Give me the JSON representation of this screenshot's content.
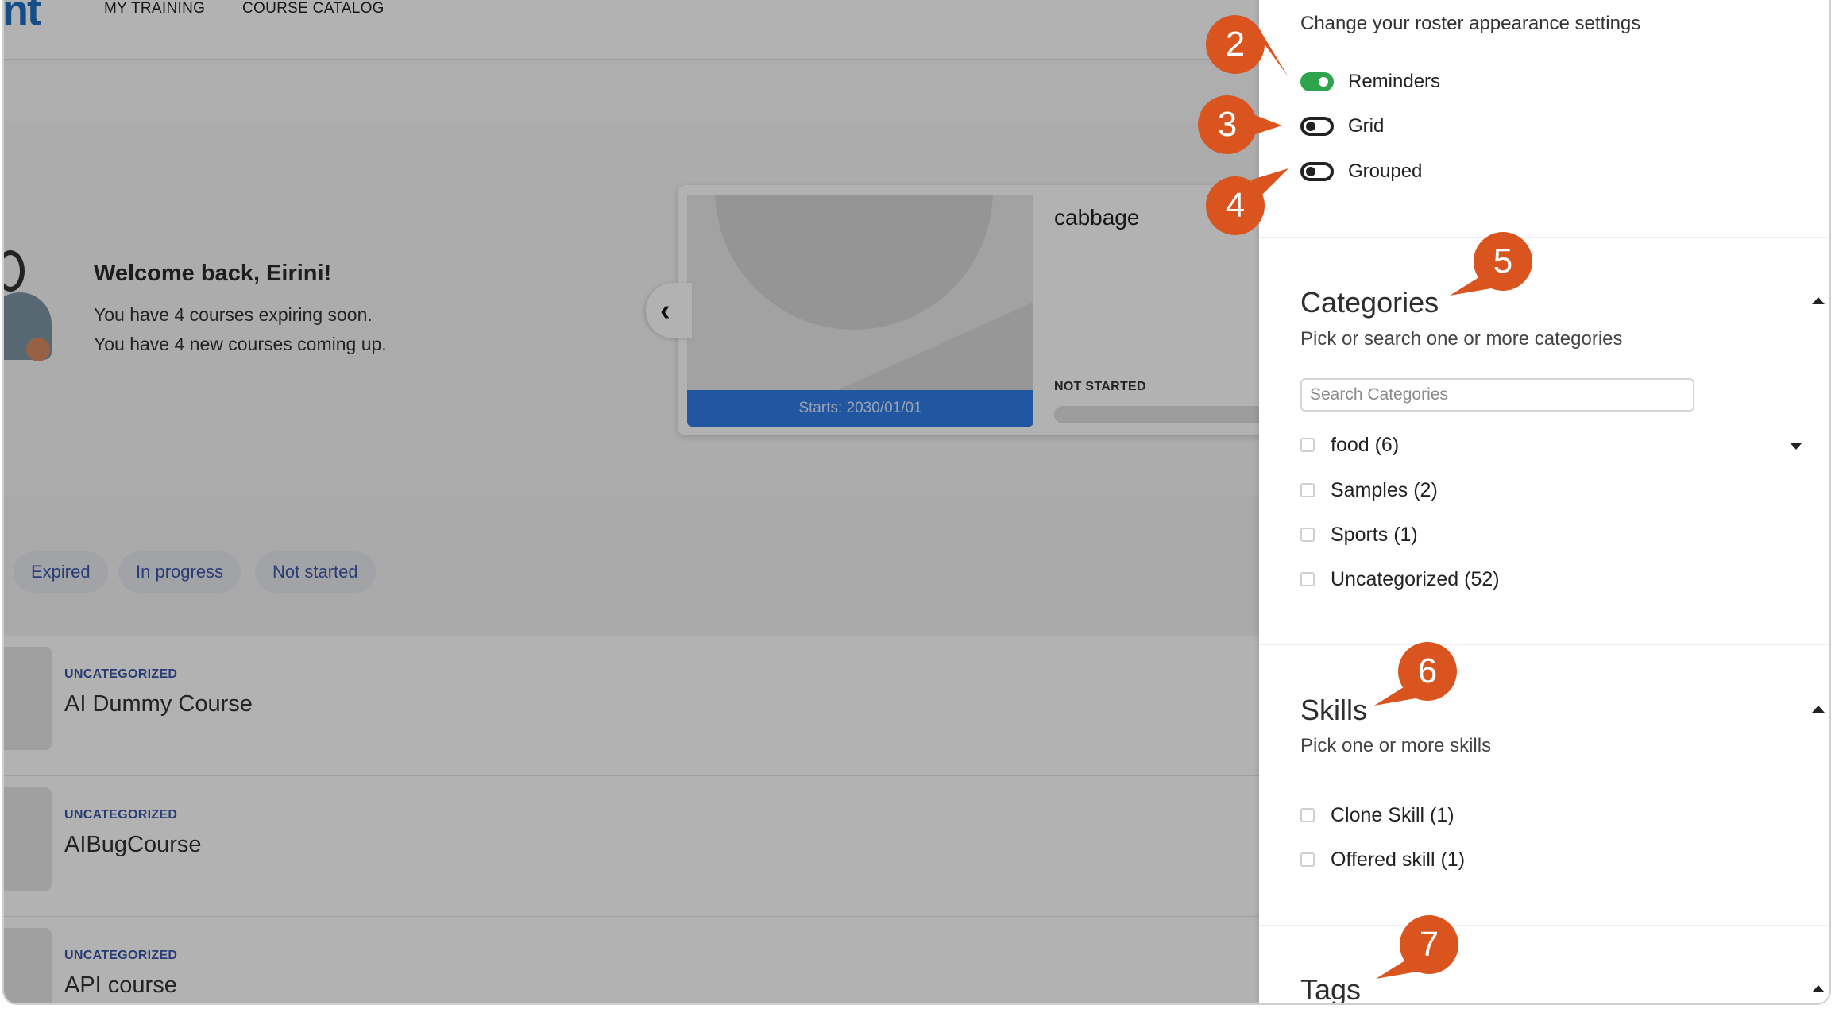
{
  "nav": {
    "logo": "nt",
    "links": [
      "MY TRAINING",
      "COURSE CATALOG"
    ]
  },
  "hero": {
    "welcome": "Welcome back, Eirini!",
    "lines": [
      "You have 4 courses expiring soon.",
      "You have 4 new courses coming up."
    ]
  },
  "card": {
    "title": "cabbage",
    "starts": "Starts: 2030/01/01",
    "status": "NOT STARTED"
  },
  "filters": [
    "Expired",
    "In progress",
    "Not started"
  ],
  "courses": [
    {
      "category": "UNCATEGORIZED",
      "title": "AI Dummy Course"
    },
    {
      "category": "UNCATEGORIZED",
      "title": "AIBugCourse"
    },
    {
      "category": "UNCATEGORIZED",
      "title": "API course"
    }
  ],
  "panel": {
    "appearance_desc": "Change your roster appearance settings",
    "toggles": [
      {
        "label": "Reminders",
        "state": "on"
      },
      {
        "label": "Grid",
        "state": "off"
      },
      {
        "label": "Grouped",
        "state": "off"
      }
    ],
    "categories": {
      "title": "Categories",
      "subtitle": "Pick or search one or more categories",
      "search_placeholder": "Search Categories",
      "items": [
        "food (6)",
        "Samples (2)",
        "Sports (1)",
        "Uncategorized (52)"
      ]
    },
    "skills": {
      "title": "Skills",
      "subtitle": "Pick one or more skills",
      "items": [
        "Clone Skill (1)",
        "Offered skill (1)"
      ]
    },
    "tags": {
      "title": "Tags"
    }
  },
  "callouts": [
    "2",
    "3",
    "4",
    "5",
    "6",
    "7"
  ],
  "colors": {
    "callout": "#d9541e",
    "toggle_on": "#2ea44f",
    "accent": "#3b56a6"
  }
}
